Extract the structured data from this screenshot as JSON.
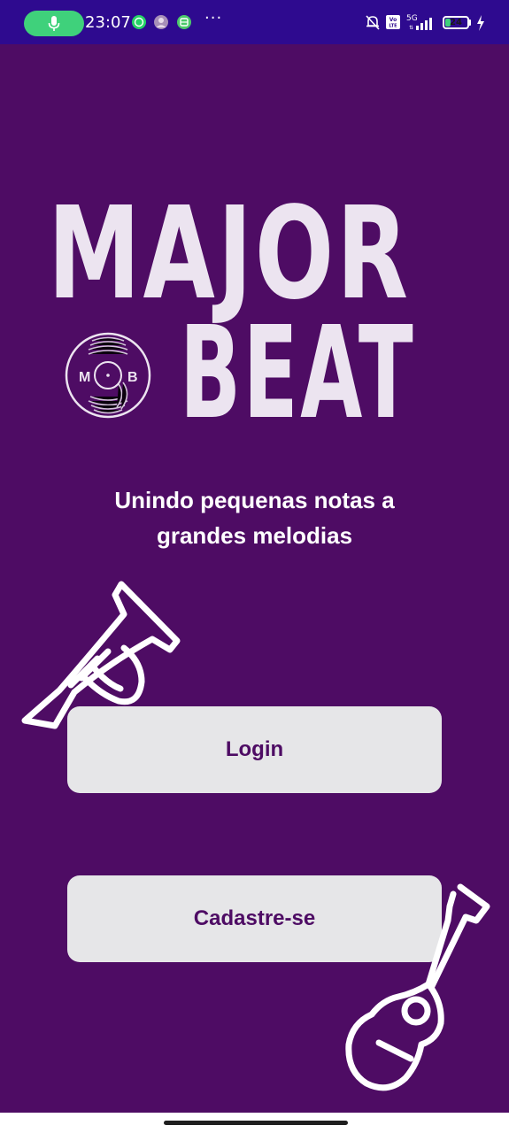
{
  "status_bar": {
    "time": "23:07",
    "network": "5G",
    "volte": "Vo LTE",
    "battery_level": "24",
    "battery_fraction": 0.24,
    "more": "···",
    "icons": [
      "mic-icon",
      "whatsapp-icon",
      "avatar-icon",
      "app-notification-icon",
      "mute-icon",
      "volte-icon",
      "signal-icon",
      "battery-icon",
      "charging-icon"
    ],
    "pill_color": "#3fd17b",
    "bar_color": "#2e0a8f"
  },
  "logo": {
    "line1": "MAJOR",
    "line2": "BEAT",
    "disc_left": "M",
    "disc_right": "B"
  },
  "tagline": {
    "line1": "Unindo pequenas notas a",
    "line2": "grandes melodias"
  },
  "buttons": {
    "login": "Login",
    "signup": "Cadastre-se"
  },
  "decorations": [
    "trumpet-icon",
    "guitar-icon"
  ],
  "colors": {
    "background": "#4e0c64",
    "button_bg": "#e6e6e8",
    "button_text": "#4e0c64",
    "logo": "#ece4f0"
  }
}
